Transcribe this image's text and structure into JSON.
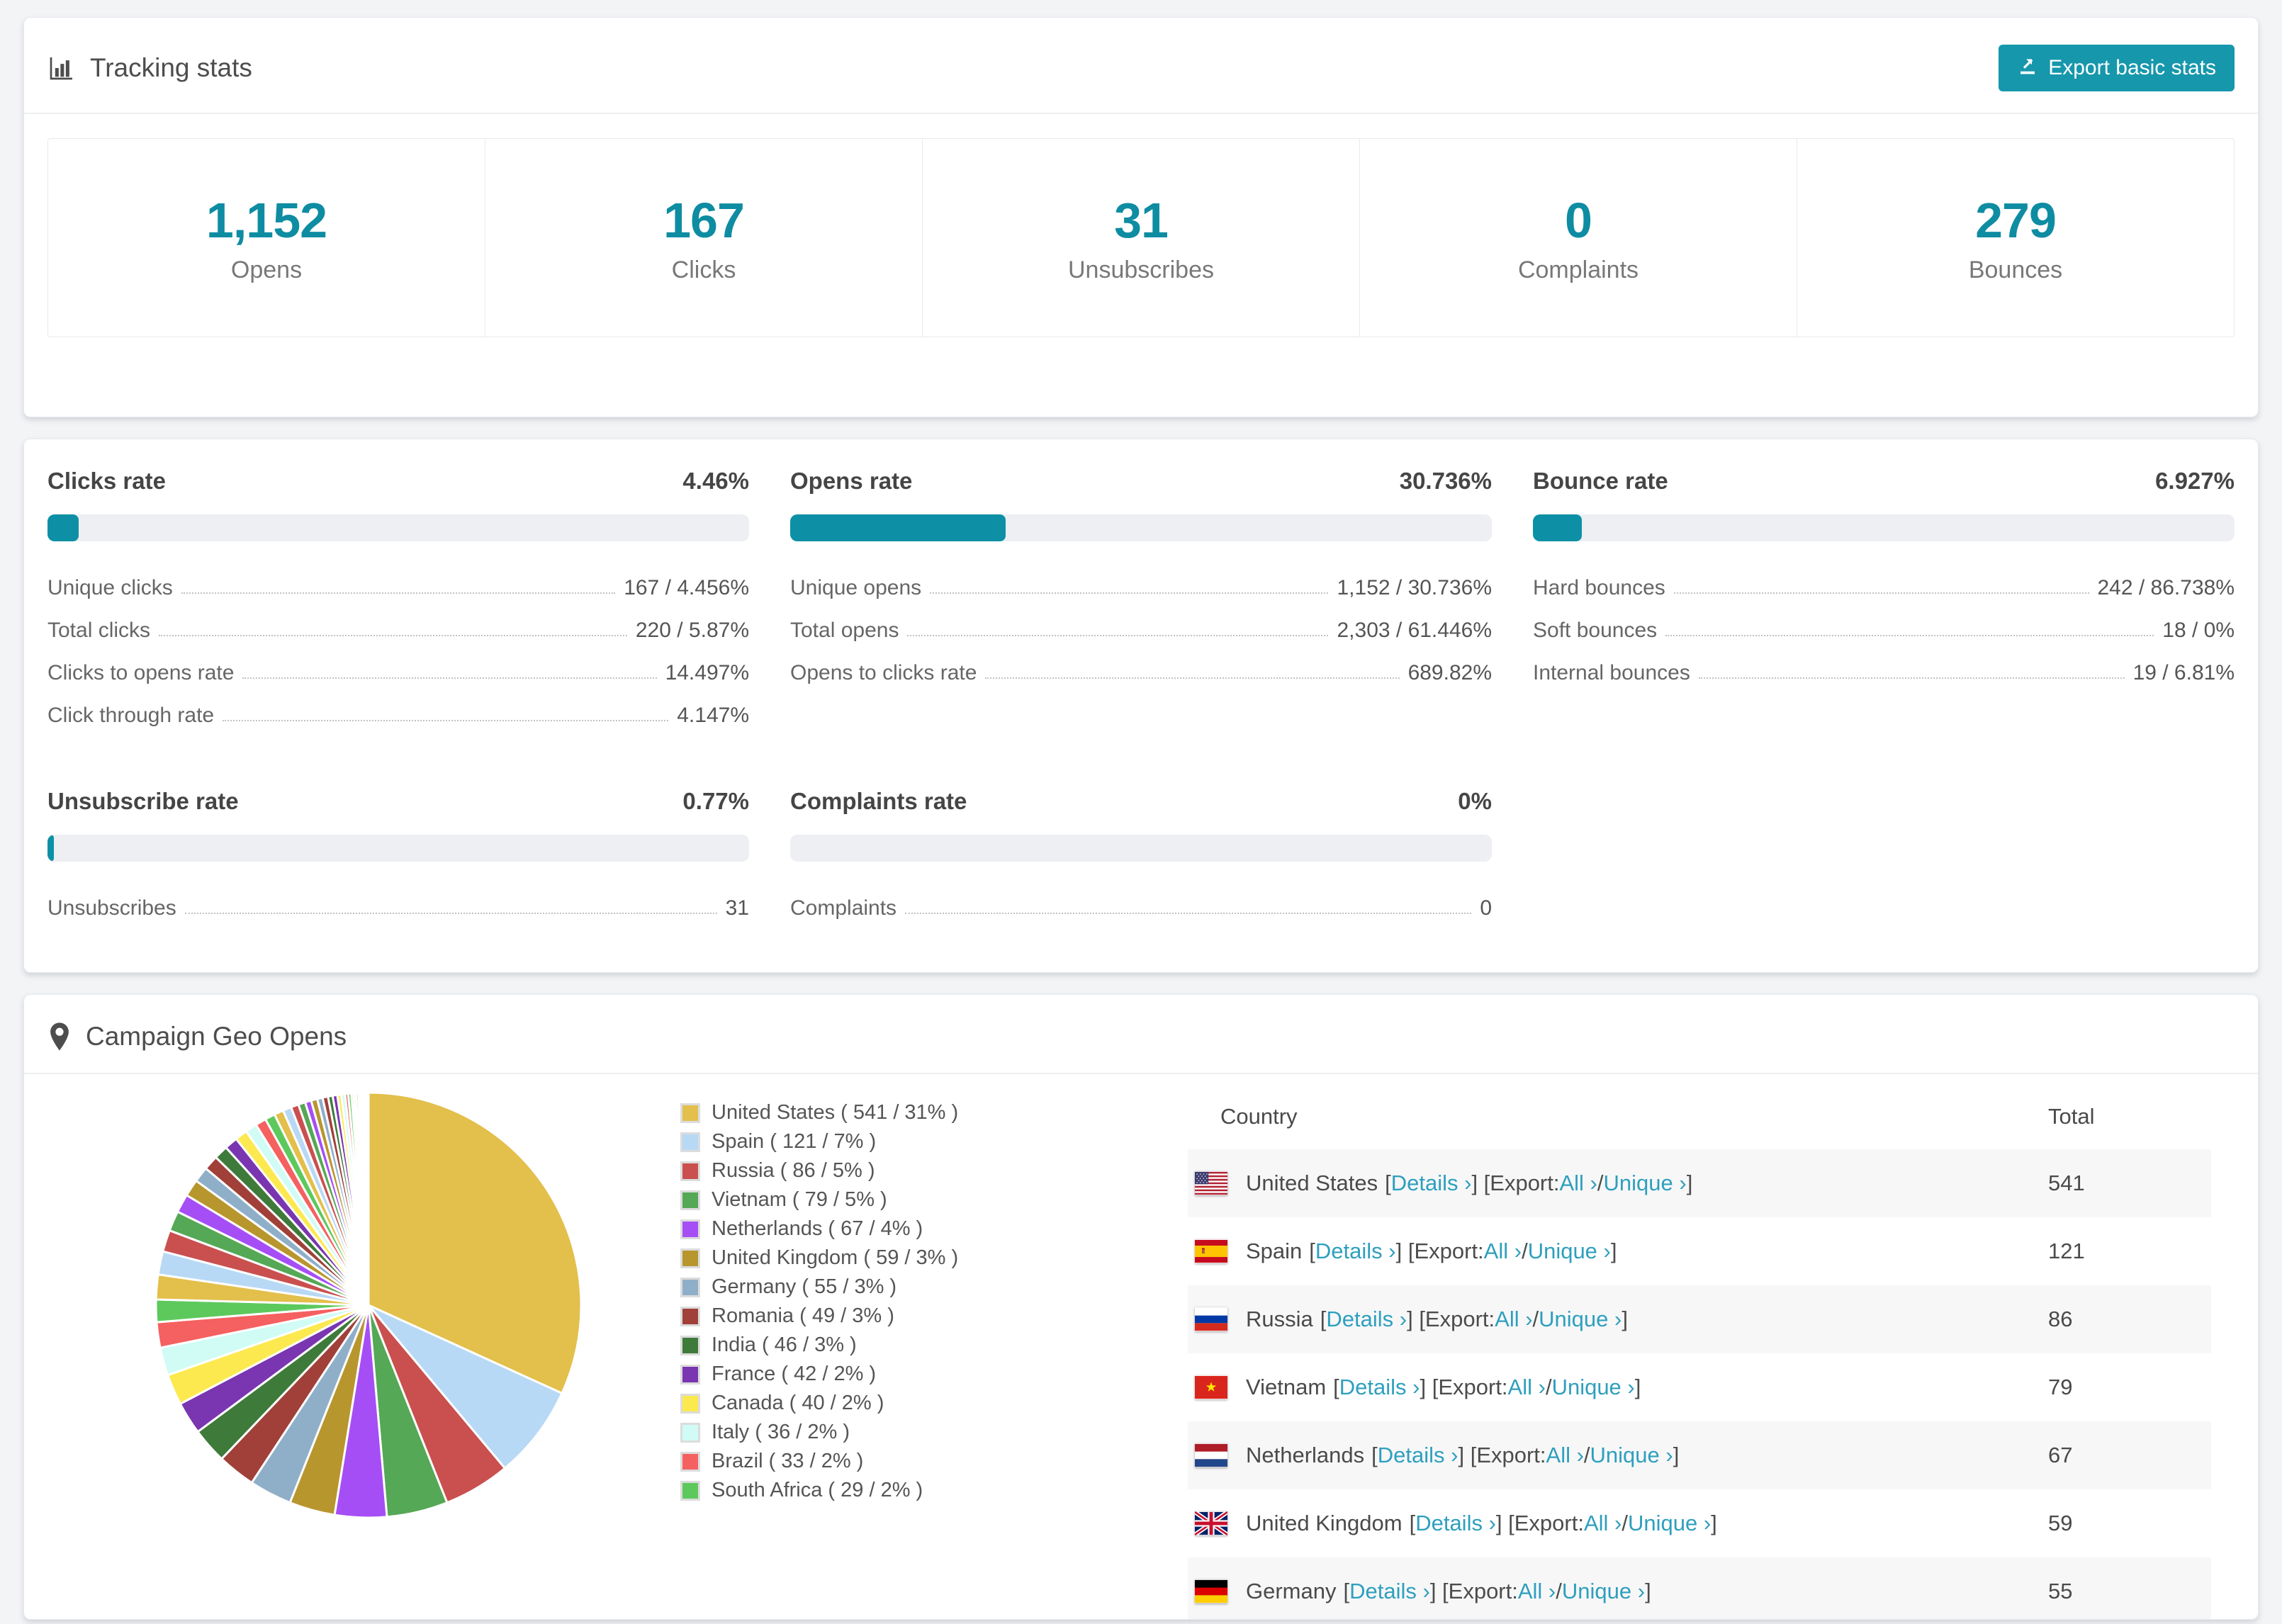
{
  "colors": {
    "accent_teal": "#1697ac",
    "stat_number_teal": "#0e8ca2",
    "progress_fill_teal": "#0d90a5",
    "link_teal": "#2e9fbe",
    "page_background": "#f3f4f6",
    "table_row_shade": "#f7f7f8"
  },
  "tracking": {
    "title": "Tracking stats",
    "export_button": "Export basic stats",
    "stats": [
      {
        "value": "1,152",
        "label": "Opens"
      },
      {
        "value": "167",
        "label": "Clicks"
      },
      {
        "value": "31",
        "label": "Unsubscribes"
      },
      {
        "value": "0",
        "label": "Complaints"
      },
      {
        "value": "279",
        "label": "Bounces"
      }
    ]
  },
  "rates": {
    "blocks": [
      {
        "title": "Clicks rate",
        "value": "4.46%",
        "pct": 4.46,
        "rows": [
          {
            "label": "Unique clicks",
            "value": "167 / 4.456%"
          },
          {
            "label": "Total clicks",
            "value": "220 / 5.87%"
          },
          {
            "label": "Clicks to opens rate",
            "value": "14.497%"
          },
          {
            "label": "Click through rate",
            "value": "4.147%"
          }
        ]
      },
      {
        "title": "Opens rate",
        "value": "30.736%",
        "pct": 30.736,
        "rows": [
          {
            "label": "Unique opens",
            "value": "1,152 / 30.736%"
          },
          {
            "label": "Total opens",
            "value": "2,303 / 61.446%"
          },
          {
            "label": "Opens to clicks rate",
            "value": "689.82%"
          }
        ]
      },
      {
        "title": "Bounce rate",
        "value": "6.927%",
        "pct": 6.927,
        "rows": [
          {
            "label": "Hard bounces",
            "value": "242 / 86.738%"
          },
          {
            "label": "Soft bounces",
            "value": "18 / 0%"
          },
          {
            "label": "Internal bounces",
            "value": "19 / 6.81%"
          }
        ]
      },
      {
        "title": "Unsubscribe rate",
        "value": "0.77%",
        "pct": 0.77,
        "rows": [
          {
            "label": "Unsubscribes",
            "value": "31"
          }
        ]
      },
      {
        "title": "Complaints rate",
        "value": "0%",
        "pct": 0,
        "rows": [
          {
            "label": "Complaints",
            "value": "0"
          }
        ]
      }
    ]
  },
  "geo": {
    "title": "Campaign Geo Opens",
    "chart_data": {
      "type": "pie",
      "title": "Campaign Geo Opens",
      "legend_position": "right",
      "start_angle_deg": -90,
      "direction": "clockwise",
      "series": [
        {
          "name": "United States",
          "value": 541,
          "pct": 31,
          "color": "#e3bf4b"
        },
        {
          "name": "Spain",
          "value": 121,
          "pct": 7,
          "color": "#b8d9f5"
        },
        {
          "name": "Russia",
          "value": 86,
          "pct": 5,
          "color": "#c9504f"
        },
        {
          "name": "Vietnam",
          "value": 79,
          "pct": 5,
          "color": "#55a855"
        },
        {
          "name": "Netherlands",
          "value": 67,
          "pct": 4,
          "color": "#a64ef5"
        },
        {
          "name": "United Kingdom",
          "value": 59,
          "pct": 3,
          "color": "#b8962e"
        },
        {
          "name": "Germany",
          "value": 55,
          "pct": 3,
          "color": "#8fafc9"
        },
        {
          "name": "Romania",
          "value": 49,
          "pct": 3,
          "color": "#a04039"
        },
        {
          "name": "India",
          "value": 46,
          "pct": 3,
          "color": "#3e7a3a"
        },
        {
          "name": "France",
          "value": 42,
          "pct": 2,
          "color": "#7a35b0"
        },
        {
          "name": "Canada",
          "value": 40,
          "pct": 2,
          "color": "#fce94f"
        },
        {
          "name": "Italy",
          "value": 36,
          "pct": 2,
          "color": "#d0fcf5"
        },
        {
          "name": "Brazil",
          "value": 33,
          "pct": 2,
          "color": "#f56060"
        },
        {
          "name": "South Africa",
          "value": 29,
          "pct": 2,
          "color": "#5dc95d"
        }
      ],
      "others_estimated": [
        32,
        30,
        28,
        26,
        24,
        22,
        20,
        19,
        18,
        17,
        16,
        15,
        14,
        13,
        12,
        11,
        10,
        9,
        8,
        8,
        7,
        7,
        6,
        6,
        5,
        5,
        4,
        4,
        3,
        3,
        3,
        2,
        2,
        2,
        2,
        1,
        1,
        1,
        1,
        1
      ]
    },
    "legend_format": {
      "open": "( ",
      "slash": " / ",
      "close": "% )"
    },
    "table": {
      "columns": [
        "Country",
        "Total"
      ],
      "details_label": "Details ›",
      "export_prefix": "Export:",
      "all_label": "All ›",
      "unique_label": "Unique ›",
      "bracket_open": "[",
      "bracket_close": "]",
      "slash": "/",
      "rows": [
        {
          "country": "United States",
          "flag": "us",
          "total": "541"
        },
        {
          "country": "Spain",
          "flag": "es",
          "total": "121"
        },
        {
          "country": "Russia",
          "flag": "ru",
          "total": "86"
        },
        {
          "country": "Vietnam",
          "flag": "vn",
          "total": "79"
        },
        {
          "country": "Netherlands",
          "flag": "nl",
          "total": "67"
        },
        {
          "country": "United Kingdom",
          "flag": "gb",
          "total": "59"
        },
        {
          "country": "Germany",
          "flag": "de",
          "total": "55"
        }
      ]
    }
  }
}
